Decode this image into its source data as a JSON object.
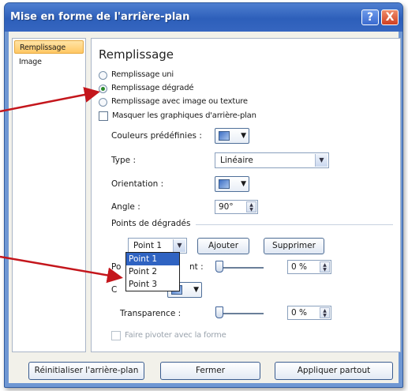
{
  "window": {
    "title": "Mise en forme de l'arrière-plan",
    "help_label": "?",
    "close_label": "X"
  },
  "nav": {
    "items": [
      {
        "label": "Remplissage",
        "selected": true
      },
      {
        "label": "Image",
        "selected": false
      }
    ]
  },
  "panel": {
    "heading": "Remplissage",
    "fill_options": [
      {
        "label": "Remplissage uni",
        "checked": false
      },
      {
        "label": "Remplissage dégradé",
        "checked": true
      },
      {
        "label": "Remplissage avec image ou texture",
        "checked": false
      }
    ],
    "hide_graphics_label": "Masquer les graphiques d'arrière-plan",
    "preset_colors_label": "Couleurs prédéfinies :",
    "type_label": "Type :",
    "type_value": "Linéaire",
    "orientation_label": "Orientation :",
    "angle_label": "Angle :",
    "angle_value": "90°",
    "stops_label": "Points de dégradés",
    "stop_select_value": "Point 1",
    "add_button": "Ajouter",
    "remove_button": "Supprimer",
    "stop_list": [
      "Point 1",
      "Point 2",
      "Point 3"
    ],
    "stop_position_suffix": "nt :",
    "stop_position_prefix": "Po",
    "stop_position_value": "0 %",
    "color_label_partial": "C",
    "transparency_label": "Transparence :",
    "transparency_value": "0 %",
    "rotate_with_shape_label": "Faire pivoter avec la forme"
  },
  "footer": {
    "reset_button": "Réinitialiser l'arrière-plan",
    "close_button": "Fermer",
    "apply_all_button": "Appliquer partout"
  },
  "colors": {
    "title_bar": "#2d5fba",
    "selected_nav": "#ffc764",
    "list_selection": "#2f63c2",
    "annotation_arrow": "#c4161c"
  },
  "icons": [
    "help-icon",
    "close-icon",
    "dropdown-arrow-icon",
    "spin-arrows-icon",
    "gradient-swatch-icon"
  ]
}
